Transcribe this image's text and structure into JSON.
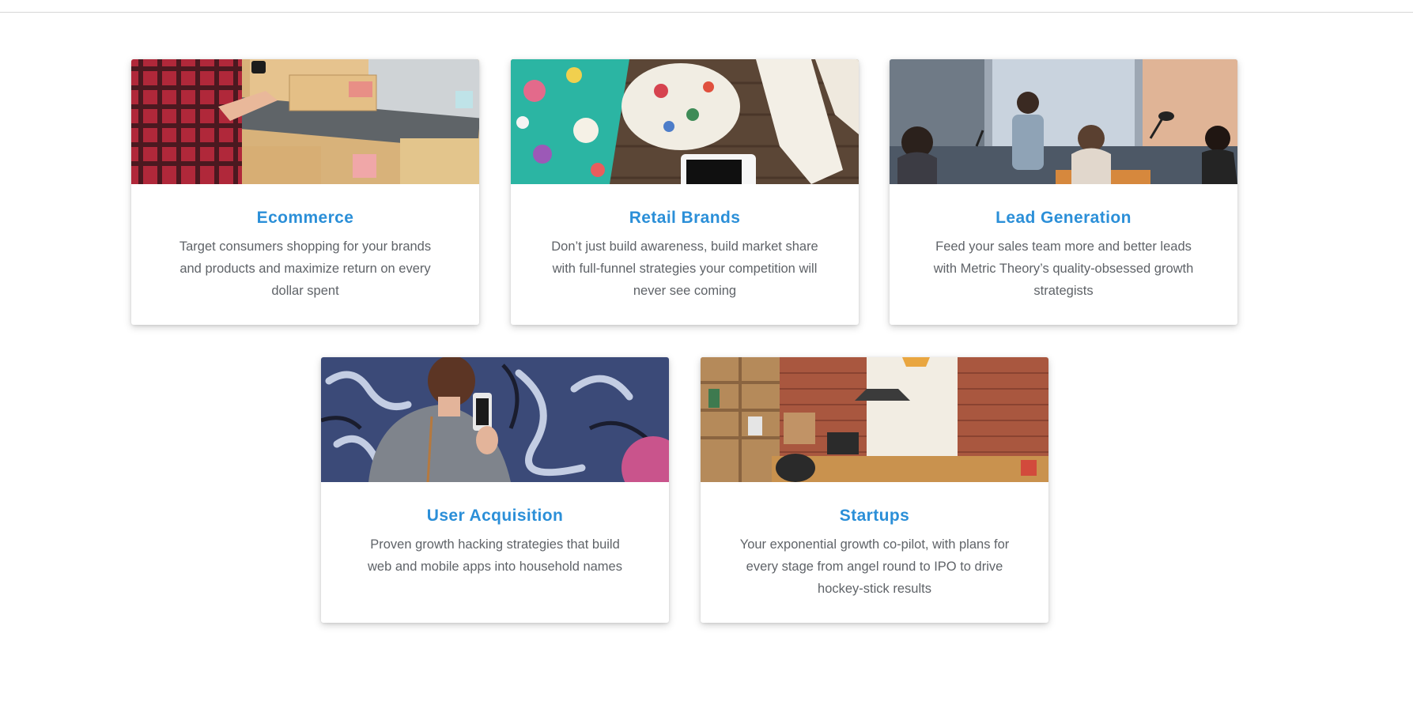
{
  "cards": [
    {
      "title": "Ecommerce",
      "description": "Target consumers shopping for your brands and products and maximize return on every dollar spent",
      "image": "packing-boxes-photo"
    },
    {
      "title": "Retail Brands",
      "description": "Don’t just build awareness, build market share with full-funnel strategies your competition will never see coming",
      "image": "floral-fashion-flatlay-photo"
    },
    {
      "title": "Lead Generation",
      "description": "Feed your sales team more and better leads with Metric Theory’s quality-obsessed growth strategists",
      "image": "office-meeting-photo"
    },
    {
      "title": "User Acquisition",
      "description": "Proven growth hacking strategies that build web and mobile apps into household names",
      "image": "woman-phone-graffiti-photo"
    },
    {
      "title": "Startups",
      "description": "Your exponential growth co-pilot, with plans for every stage from angel round to IPO to drive hockey-stick results",
      "image": "brick-office-photo"
    }
  ]
}
